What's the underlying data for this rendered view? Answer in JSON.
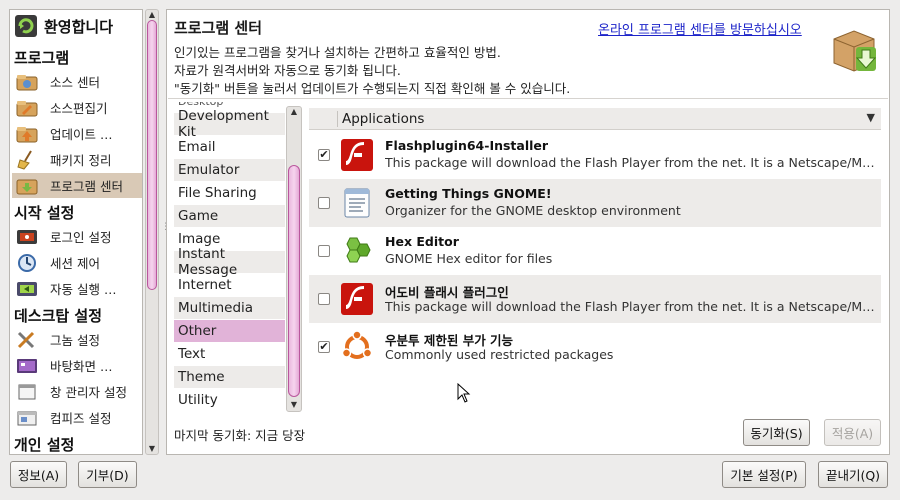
{
  "sidebar": {
    "categories": [
      "환영합니다",
      "프로그램",
      "시작 설정",
      "데스크탑 설정",
      "개인 설정"
    ],
    "items": [
      {
        "label": "소스 센터",
        "icon": "software-sources-icon"
      },
      {
        "label": "소스편집기",
        "icon": "source-editor-icon"
      },
      {
        "label": "업데이트 …",
        "icon": "update-icon"
      },
      {
        "label": "패키지 정리",
        "icon": "broom-icon"
      },
      {
        "label": "프로그램 센터",
        "icon": "program-center-icon"
      },
      {
        "label": "로그인 설정",
        "icon": "login-settings-icon"
      },
      {
        "label": "세션 제어",
        "icon": "session-control-icon"
      },
      {
        "label": "자동 실행 …",
        "icon": "autostart-icon"
      },
      {
        "label": "그놈 설정",
        "icon": "gnome-settings-icon"
      },
      {
        "label": "바탕화면 …",
        "icon": "desktop-icon"
      },
      {
        "label": "창 관리자 설정",
        "icon": "window-manager-icon"
      },
      {
        "label": "컴피즈 설정",
        "icon": "compiz-icon"
      }
    ]
  },
  "header": {
    "title": "프로그램 센터",
    "link": "온라인 프로그램 센터를 방문하십시오",
    "desc1": "인기있는 프로그램을 찾거나 설치하는 간편하고 효율적인 방법.",
    "desc2": "자료가 원격서버와 자동으로 동기화 됩니다.",
    "desc3": "\"동기화\" 버튼을 눌러서 업데이트가 수행되는지 직접 확인해 볼 수 있습니다."
  },
  "groups": {
    "partial": "Desktop",
    "items": [
      "Development Kit",
      "Email",
      "Emulator",
      "File Sharing",
      "Game",
      "Image",
      "Instant Message",
      "Internet",
      "Multimedia",
      "Other",
      "Text",
      "Theme",
      "Utility"
    ],
    "selected": "Other"
  },
  "packages": {
    "column": "Applications",
    "rows": [
      {
        "name": "Flashplugin64-Installer",
        "desc": "This package will download the Flash Player from the net. It is a  Netscape/Mozilla-compatible plugin",
        "checked": true,
        "icon": "flash-icon"
      },
      {
        "name": "Getting Things GNOME!",
        "desc": "Organizer for the GNOME desktop environment",
        "checked": false,
        "icon": "notepad-icon"
      },
      {
        "name": "Hex Editor",
        "desc": "GNOME Hex editor for files",
        "checked": false,
        "icon": "hex-editor-icon"
      },
      {
        "name": "어도비 플래시 플러그인",
        "desc": "This package will download the Flash Player from the net. It is a Netscape/Mozilla-compatible plugin",
        "checked": false,
        "icon": "flash-icon"
      },
      {
        "name": "우분투 제한된 부가 기능",
        "desc": "Commonly used restricted packages",
        "checked": true,
        "icon": "ubuntu-icon"
      }
    ]
  },
  "status": {
    "last_sync": "마지막 동기화: 지금 당장"
  },
  "buttons": {
    "sync": "동기화(S)",
    "apply": "적용(A)",
    "about": "정보(A)",
    "donate": "기부(D)",
    "defaults": "기본 설정(P)",
    "quit": "끝내기(Q)"
  },
  "colors": {
    "selection": "#e1b3d8",
    "sidebar_selection": "#d9c9b6",
    "link": "#1d24c9",
    "scrollbar": "#e9b7dd"
  }
}
